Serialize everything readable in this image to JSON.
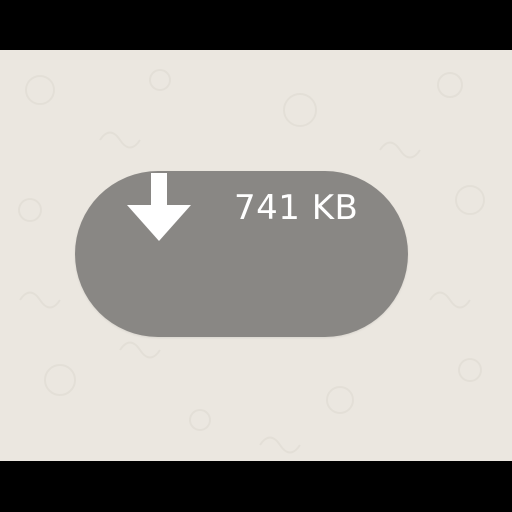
{
  "background_color": "#ebe7e0",
  "download_button": {
    "icon": "download-arrow-icon",
    "file_size": "741 KB",
    "fill_color": "#898784",
    "text_color": "#ffffff"
  }
}
